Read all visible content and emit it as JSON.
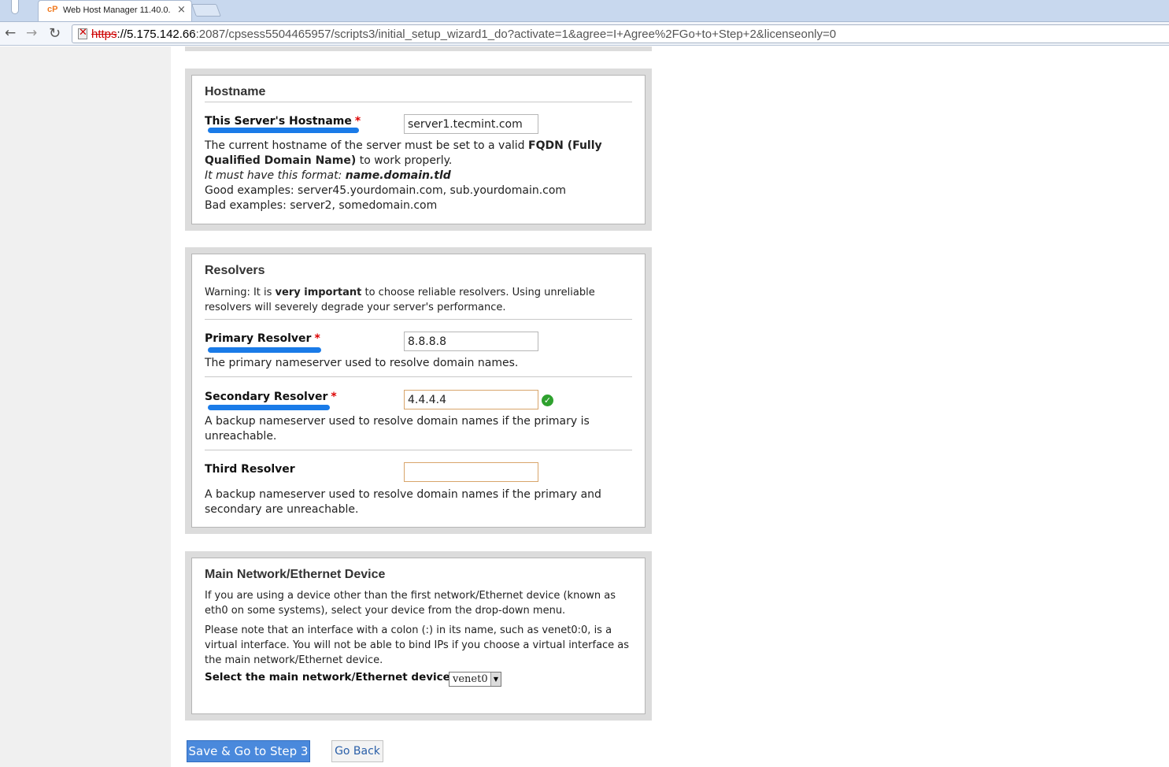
{
  "browser": {
    "tab_favicon": "cP",
    "tab_title": "Web Host Manager 11.40.0.",
    "tab_close": "×",
    "back_icon": "←",
    "forward_icon": "→",
    "reload_icon": "↻",
    "url_proto": "https",
    "url_host": "://5.175.142.66",
    "url_rest": ":2087/cpsess5504465957/scripts3/initial_setup_wizard1_do?activate=1&agree=I+Agree%2FGo+to+Step+2&licenseonly=0"
  },
  "hostname": {
    "title": "Hostname",
    "label": "This Server's Hostname",
    "required": "*",
    "value": "server1.tecmint.com",
    "desc_prefix": "The current hostname of the server must be set to a valid ",
    "desc_bold": "FQDN (Fully Qualified Domain Name)",
    "desc_suffix": " to work properly.",
    "format_intro": "It must have this format: ",
    "format_value": "name.domain.tld",
    "good_examples": "Good examples: server45.yourdomain.com, sub.yourdomain.com",
    "bad_examples": "Bad examples: server2, somedomain.com"
  },
  "resolvers": {
    "title": "Resolvers",
    "warning_prefix": "Warning: It is ",
    "warning_bold": "very important",
    "warning_suffix": " to choose reliable resolvers. Using unreliable resolvers will severely degrade your server's performance.",
    "primary": {
      "label": "Primary Resolver",
      "required": "*",
      "value": "8.8.8.8",
      "desc": "The primary nameserver used to resolve domain names."
    },
    "secondary": {
      "label": "Secondary Resolver",
      "required": "*",
      "value": "4.4.4.4",
      "check": "✓",
      "desc": "A backup nameserver used to resolve domain names if the primary is unreachable."
    },
    "third": {
      "label": "Third Resolver",
      "value": "",
      "desc": "A backup nameserver used to resolve domain names if the primary and secondary are unreachable."
    }
  },
  "network": {
    "title": "Main Network/Ethernet Device",
    "desc1": "If you are using a device other than the first network/Ethernet device (known as eth0 on some systems), select your device from the drop-down menu.",
    "desc2": "Please note that an interface with a colon (:) in its name, such as venet0:0, is a virtual interface. You will not be able to bind IPs if you choose a virtual interface as the main network/Ethernet device.",
    "select_label": "Select the main network/Ethernet device:",
    "select_value": "venet0",
    "select_arrow": "▼"
  },
  "actions": {
    "save_label": "Save & Go to Step 3",
    "back_label": "Go Back"
  },
  "colors": {
    "accent": "#4a89dc",
    "required": "#dd0000",
    "annotation_underline": "#1a7be8",
    "valid_check": "#2ea12e"
  }
}
